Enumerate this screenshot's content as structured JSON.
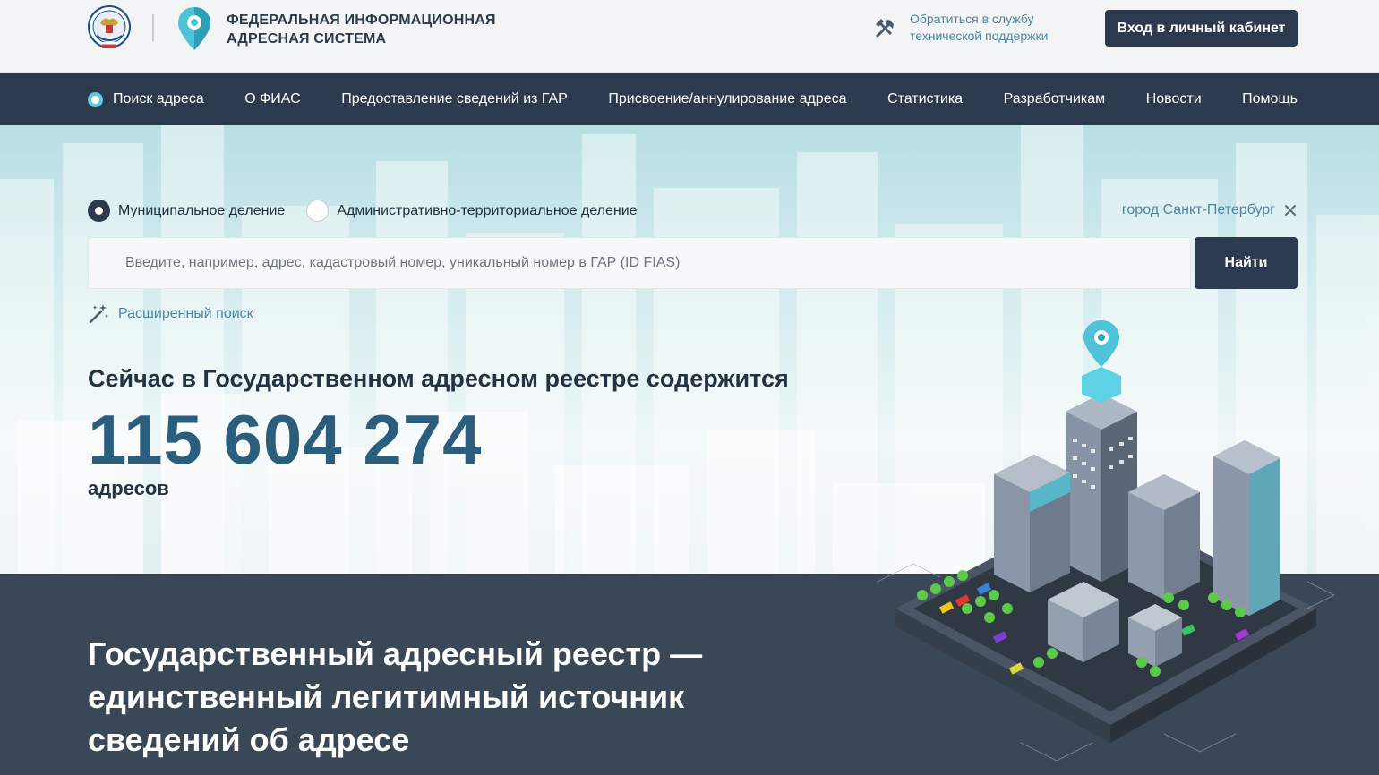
{
  "header": {
    "title_line1": "ФЕДЕРАЛЬНАЯ ИНФОРМАЦИОННАЯ",
    "title_line2": "АДРЕСНАЯ СИСТЕМА",
    "support_line1": "Обратиться в службу",
    "support_line2": "технической поддержки",
    "login_label": "Вход в личный кабинет"
  },
  "nav": {
    "items": [
      {
        "label": "Поиск адреса"
      },
      {
        "label": "О ФИАС"
      },
      {
        "label": "Предоставление сведений из ГАР"
      },
      {
        "label": "Присвоение/аннулирование адреса"
      },
      {
        "label": "Статистика"
      },
      {
        "label": "Разработчикам"
      },
      {
        "label": "Новости"
      },
      {
        "label": "Помощь"
      }
    ]
  },
  "search": {
    "radio_municipal": "Муниципальное деление",
    "radio_admin": "Административно-территориальное деление",
    "selected": "municipal",
    "region": "город Санкт-Петербург",
    "placeholder": "Введите, например, адрес, кадастровый номер, уникальный номер в ГАР (ID FIAS)",
    "button_label": "Найти",
    "advanced_label": "Расширенный поиск"
  },
  "stats": {
    "title": "Сейчас в Государственном адресном реестре содержится",
    "count": "115 604 274",
    "unit": "адресов"
  },
  "tagline": {
    "line1": "Государственный адресный реестр —",
    "line2": "единственный легитимный источник",
    "line3": "сведений об адресе"
  },
  "colors": {
    "navy": "#2b3a4e",
    "accent_link": "#4c86a6",
    "number": "#2b5d7d",
    "pin": "#4fc3d9"
  },
  "icons": {
    "emblem": "fns-emblem-icon",
    "logo": "map-pin-logo-icon",
    "support": "tools-icon",
    "close": "close-icon",
    "advanced": "magic-wand-icon"
  }
}
